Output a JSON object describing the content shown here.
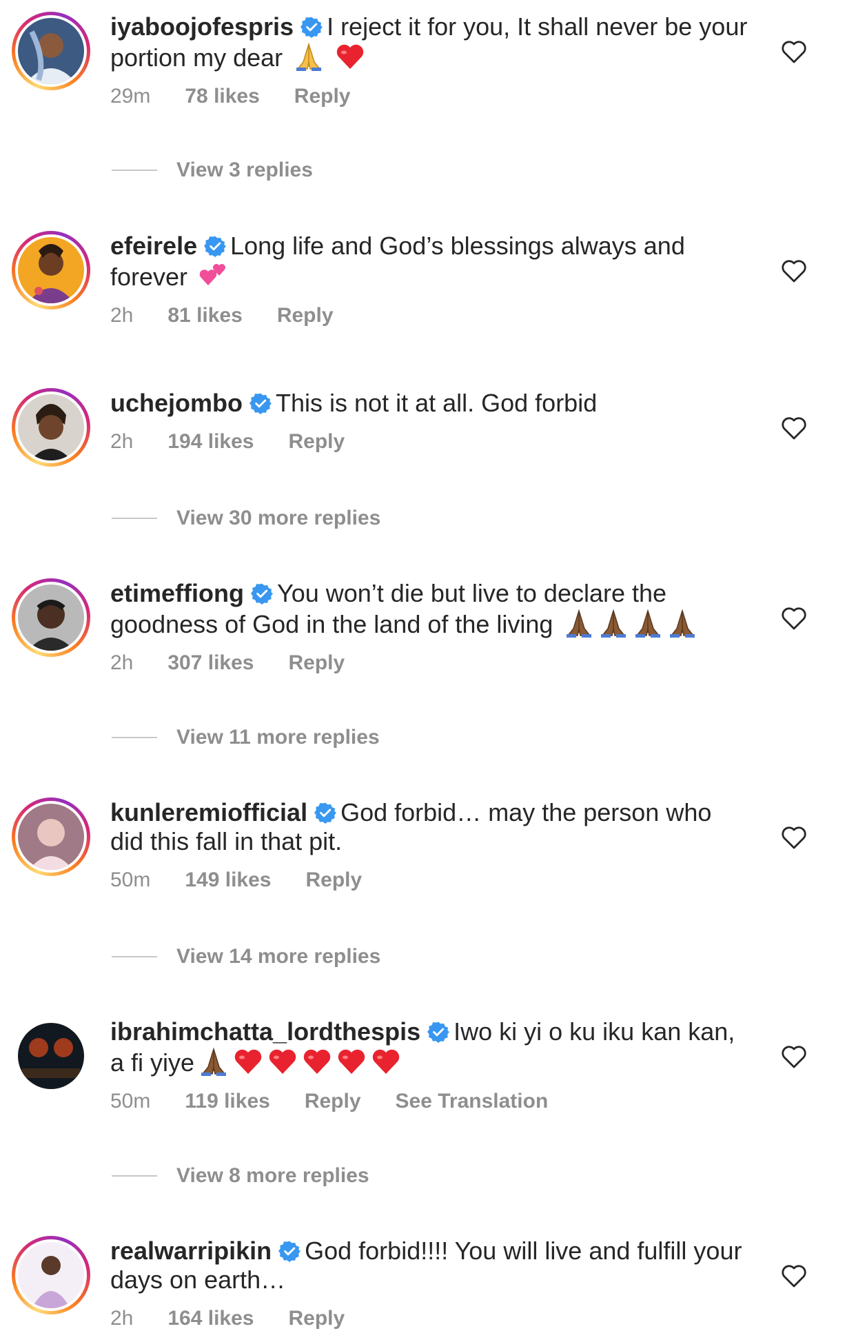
{
  "colors": {
    "text": "#262626",
    "meta": "#8e8e8e",
    "verified": "#3897f0",
    "ring_start": "#feda75",
    "ring_mid": "#d62976",
    "ring_end": "#962fbf"
  },
  "comments": [
    {
      "username": "iyaboojofespris",
      "text": "I reject it for you, It shall never be your portion my dear",
      "emojis": [
        "folded-hands",
        "red-heart"
      ],
      "time": "29m",
      "likes": "78 likes",
      "reply": "Reply",
      "view_replies": "View 3 replies"
    },
    {
      "username": "efeirele",
      "text": "Long life and God’s blessings always and forever",
      "emojis": [
        "two-hearts"
      ],
      "time": "2h",
      "likes": "81 likes",
      "reply": "Reply"
    },
    {
      "username": "uchejombo",
      "text": "This is not it at all. God forbid",
      "emojis": [],
      "time": "2h",
      "likes": "194 likes",
      "reply": "Reply",
      "view_replies": "View 30 more replies"
    },
    {
      "username": "etimeffiong",
      "text": "You won’t die but live to declare the goodness of God in the land of the living",
      "emojis": [
        "folded-hands-dark",
        "folded-hands-dark",
        "folded-hands-dark",
        "folded-hands-dark"
      ],
      "time": "2h",
      "likes": "307 likes",
      "reply": "Reply",
      "view_replies": "View 11 more replies"
    },
    {
      "username": "kunleremiofficial",
      "text": "God forbid… may the person who did this fall in that pit.",
      "emojis": [],
      "time": "50m",
      "likes": "149 likes",
      "reply": "Reply",
      "view_replies": "View 14 more replies"
    },
    {
      "username": "ibrahimchatta_lordthespis",
      "text": "Iwo ki yi o ku iku kan kan, a fi yiye",
      "emojis": [
        "folded-hands-dark",
        "red-heart",
        "red-heart",
        "red-heart",
        "red-heart",
        "red-heart"
      ],
      "time": "50m",
      "likes": "119 likes",
      "reply": "Reply",
      "translate": "See Translation",
      "view_replies": "View 8 more replies"
    },
    {
      "username": "realwarripikin",
      "text": "God forbid!!!! You will live and fulfill your days on earth…",
      "emojis": [],
      "time": "2h",
      "likes": "164 likes",
      "reply": "Reply"
    }
  ]
}
